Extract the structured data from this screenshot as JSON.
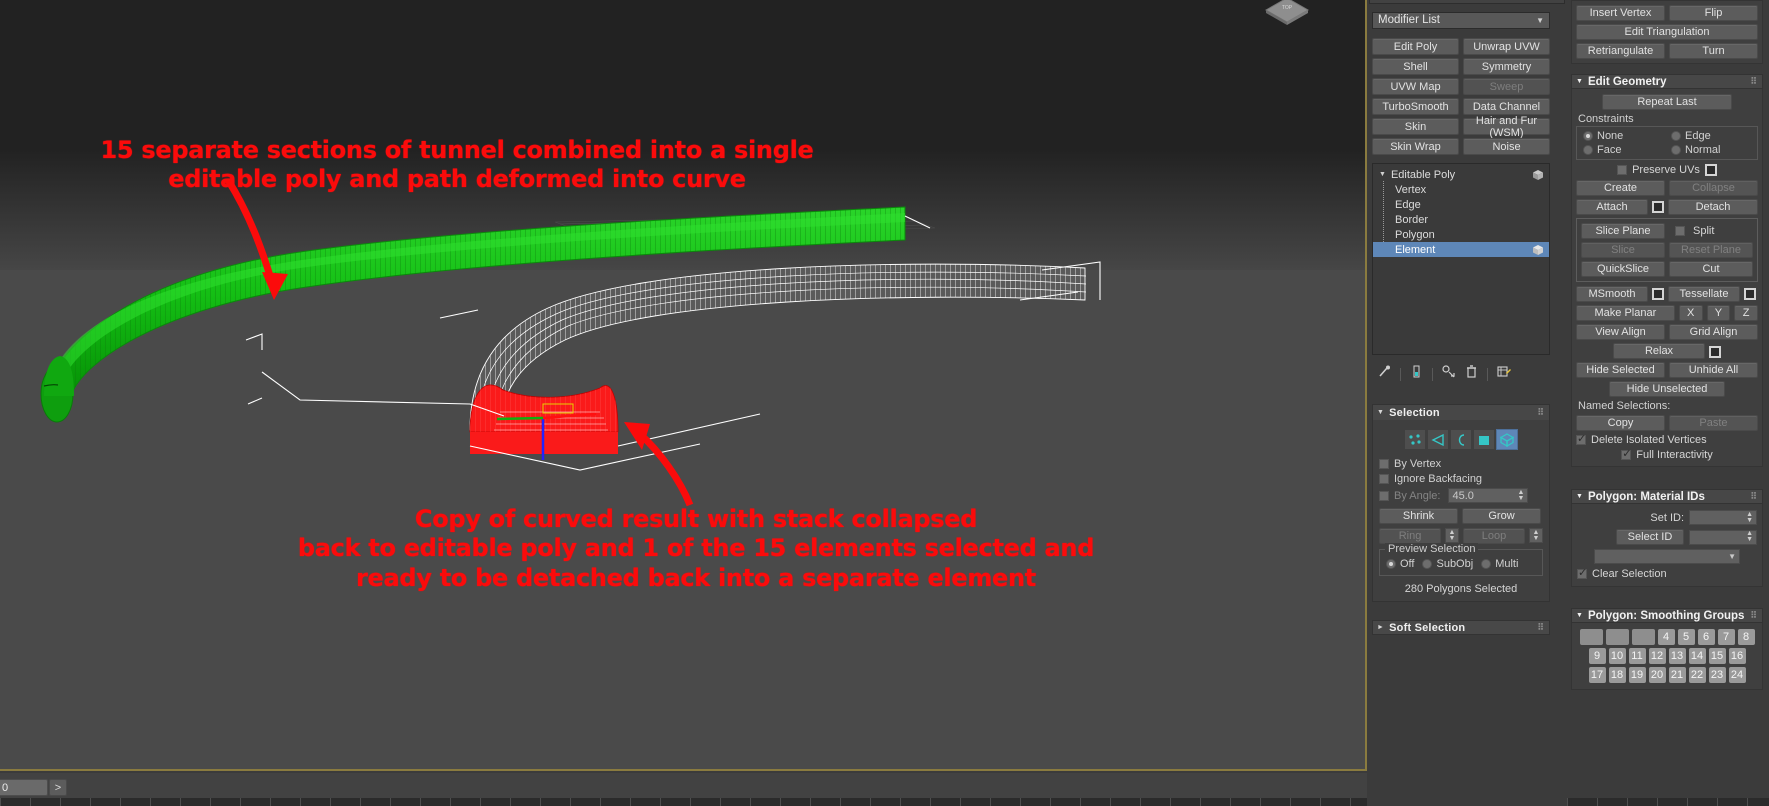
{
  "viewport": {
    "viewcube_label": "view-cube",
    "annotations": {
      "top": "15 separate sections of tunnel combined into a single\neditable poly and path deformed into curve",
      "bottom": "Copy of curved result with stack collapsed\nback to editable poly and 1 of the 15 elements selected and\nready to be detached back into a separate element",
      "color": "#fb0b0b"
    },
    "objects": {
      "green_tunnel_color": "#12b312",
      "white_tunnel_color": "#ffffff",
      "selected_cap_color": "#fa1616",
      "gizmo_axis_x": "#ff0000",
      "gizmo_axis_y": "#00c000",
      "gizmo_axis_z": "#2222ff"
    }
  },
  "command_panel": {
    "modifier_list": {
      "label": "Modifier List",
      "caret": "chevron-down-icon"
    },
    "modifier_buttons": [
      [
        "Edit Poly",
        "Unwrap UVW"
      ],
      [
        "Shell",
        "Symmetry"
      ],
      [
        "UVW Map",
        "Sweep"
      ],
      [
        "TurboSmooth",
        "Data Channel"
      ],
      [
        "Skin",
        "Hair and Fur (WSM)"
      ],
      [
        "Skin Wrap",
        "Noise"
      ]
    ],
    "disabled_modifier_buttons": [
      "Sweep"
    ],
    "stack": {
      "root": "Editable Poly",
      "children": [
        "Vertex",
        "Edge",
        "Border",
        "Polygon",
        "Element"
      ],
      "selected": "Element"
    },
    "stack_tools": [
      "pin-stack-icon",
      "show-end-result-icon",
      "make-unique-icon",
      "remove-modifier-icon",
      "configure-modifier-sets-icon"
    ],
    "selection_rollout": {
      "title": "Selection",
      "subobject_icons": [
        "vertex-icon",
        "edge-icon",
        "border-icon",
        "polygon-icon",
        "element-icon"
      ],
      "subobject_active": "element-icon",
      "by_vertex": {
        "label": "By Vertex",
        "checked": false
      },
      "ignore_backfacing": {
        "label": "Ignore Backfacing",
        "checked": false
      },
      "by_angle": {
        "label": "By Angle:",
        "checked": false,
        "value": "45.0",
        "disabled": true
      },
      "shrink": "Shrink",
      "grow": "Grow",
      "ring": "Ring",
      "loop": "Loop",
      "preview_selection": {
        "legend": "Preview Selection",
        "options": [
          "Off",
          "SubObj",
          "Multi"
        ],
        "selected": "Off"
      },
      "status": "280 Polygons Selected"
    },
    "soft_selection_rollout": {
      "title": "Soft Selection",
      "collapsed": true
    }
  },
  "right_panel": {
    "edit_polygons_buttons": [
      [
        "Insert Vertex",
        "Flip"
      ],
      [
        "Edit Triangulation"
      ],
      [
        "Retriangulate",
        "Turn"
      ]
    ],
    "edit_geometry": {
      "title": "Edit Geometry",
      "repeat_last": "Repeat Last",
      "constraints": {
        "legend": "Constraints",
        "options": [
          "None",
          "Edge",
          "Face",
          "Normal"
        ],
        "selected": "None"
      },
      "preserve_uvs": {
        "label": "Preserve UVs",
        "checked": false
      },
      "create": "Create",
      "collapse": "Collapse",
      "attach": "Attach",
      "detach": "Detach",
      "slice_plane": "Slice Plane",
      "split": {
        "label": "Split",
        "checked": false
      },
      "slice": "Slice",
      "reset_plane": "Reset Plane",
      "quickslice": "QuickSlice",
      "cut": "Cut",
      "msmooth": "MSmooth",
      "tessellate": "Tessellate",
      "make_planar": "Make Planar",
      "axis_buttons": [
        "X",
        "Y",
        "Z"
      ],
      "view_align": "View Align",
      "grid_align": "Grid Align",
      "relax": "Relax",
      "hide_selected": "Hide Selected",
      "unhide_all": "Unhide All",
      "hide_unselected": "Hide Unselected",
      "named_selections_label": "Named Selections:",
      "copy": "Copy",
      "paste": "Paste",
      "delete_isolated_vertices": {
        "label": "Delete Isolated Vertices",
        "checked": true
      },
      "full_interactivity": {
        "label": "Full Interactivity",
        "checked": true
      },
      "disabled": [
        "Collapse",
        "Slice",
        "Reset Plane",
        "Paste"
      ]
    },
    "material_ids": {
      "title": "Polygon: Material IDs",
      "set_id_label": "Set ID:",
      "set_id_value": "",
      "select_id": "Select ID",
      "select_id_value": "",
      "id_dropdown_value": "",
      "clear_selection": {
        "label": "Clear Selection",
        "checked": true
      }
    },
    "smoothing_groups": {
      "title": "Polygon: Smoothing Groups",
      "rows": [
        [
          "",
          "",
          "",
          "4",
          "5",
          "6",
          "7",
          "8"
        ],
        [
          "9",
          "10",
          "11",
          "12",
          "13",
          "14",
          "15",
          "16"
        ],
        [
          "17",
          "18",
          "19",
          "20",
          "21",
          "22",
          "23",
          "24"
        ]
      ]
    }
  },
  "bottom_bar": {
    "frame_value": "0",
    "next_button": ">"
  }
}
